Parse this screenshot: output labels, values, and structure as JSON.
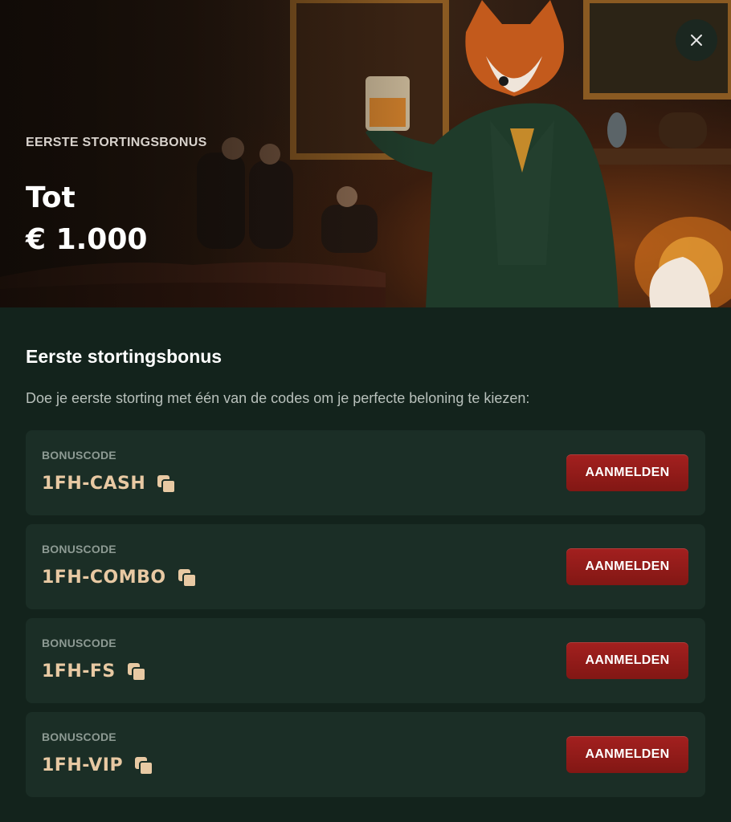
{
  "hero": {
    "eyebrow": "EERSTE STORTINGSBONUS",
    "title_line1": "Tot",
    "title_line2": "€ 1.000",
    "close_icon": "close-icon"
  },
  "section": {
    "title": "Eerste stortingsbonus",
    "description": "Doe je eerste storting met één van de codes om je perfecte beloning te kiezen:"
  },
  "codes": [
    {
      "label": "BONUSCODE",
      "code": "1FH-CASH",
      "button": "AANMELDEN"
    },
    {
      "label": "BONUSCODE",
      "code": "1FH-COMBO",
      "button": "AANMELDEN"
    },
    {
      "label": "BONUSCODE",
      "code": "1FH-FS",
      "button": "AANMELDEN"
    },
    {
      "label": "BONUSCODE",
      "code": "1FH-VIP",
      "button": "AANMELDEN"
    }
  ],
  "colors": {
    "background": "#13231c",
    "card": "#1b2e26",
    "code_text": "#e8c9a3",
    "button": "#a3201f"
  }
}
